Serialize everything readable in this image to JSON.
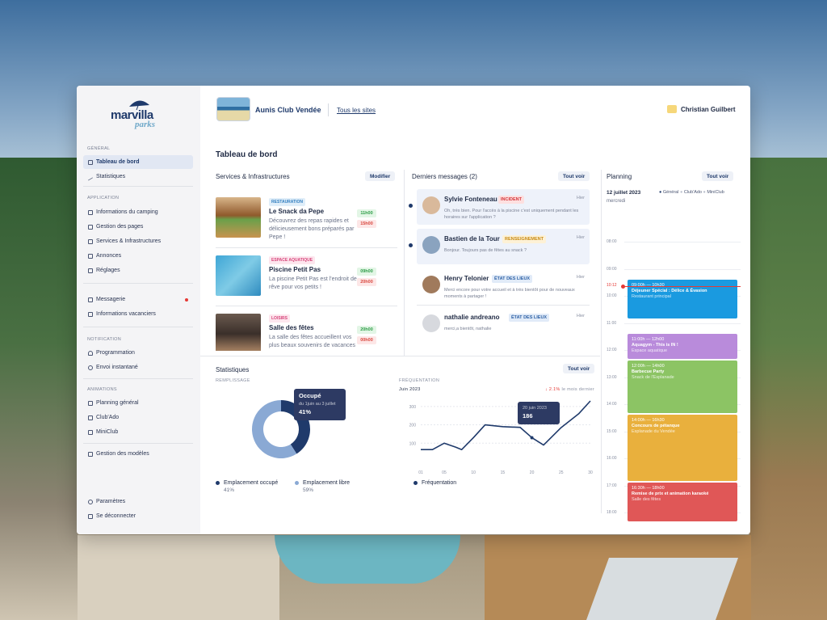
{
  "brand": {
    "logo_main": "marvilla",
    "logo_sub": "parks"
  },
  "site": {
    "name": "Aunis Club Vendée",
    "all_sites": "Tous les sites"
  },
  "user": {
    "name": "Christian Guilbert"
  },
  "sidebar": {
    "sections": {
      "general": "GÉNÉRAL",
      "application": "APPLICATION",
      "notification": "NOTIFICATION",
      "animations": "ANIMATIONS"
    },
    "items": {
      "dashboard": "Tableau de bord",
      "stats": "Statistiques",
      "camping": "Informations du camping",
      "pages": "Gestion des pages",
      "services": "Services & Infrastructures",
      "annonces": "Annonces",
      "reglages": "Réglages",
      "messagerie": "Messagerie",
      "infos_vacanciers": "Informations vacanciers",
      "programmation": "Programmation",
      "envoi": "Envoi instantané",
      "planning": "Planning général",
      "clubado": "Club'Ado",
      "miniclub": "MiniClub",
      "modeles": "Gestion des modèles",
      "parametres": "Paramètres",
      "deconnexion": "Se déconnecter"
    }
  },
  "page_title": "Tableau de bord",
  "services": {
    "title": "Services & Infrastructures",
    "edit": "Modifier",
    "items": [
      {
        "tag": "RESTAURATION",
        "name": "Le Snack da Pepe",
        "desc": "Découvrez des repas rapides et délicieusement bons préparés par Pepe !",
        "open": "11h00",
        "close": "15h00"
      },
      {
        "tag": "ESPACE AQUATIQUE",
        "name": "Piscine Petit Pas",
        "desc": "La piscine Petit Pas est l'endroit de rêve pour vos petits !",
        "open": "09h00",
        "close": "20h00"
      },
      {
        "tag": "LOISIRS",
        "name": "Salle des fêtes",
        "desc": "La salle des fêtes accueillent vos plus beaux souvenirs de vacances",
        "open": "20h00",
        "close": "00h00"
      }
    ]
  },
  "messages": {
    "title": "Derniers messages (2)",
    "see_all": "Tout voir",
    "items": [
      {
        "name": "Sylvie Fonteneau",
        "tag": "INCIDENT",
        "date": "Hier",
        "preview": "Oh, très bien. Pour l'accès à la piscine c'est uniquement pendant les horaires sur l'application ?"
      },
      {
        "name": "Bastien de la Tour",
        "tag": "RENSEIGNEMENT",
        "date": "Hier",
        "preview": "Bonjour. Toujours pas de fêtes au snack ?"
      },
      {
        "name": "Henry Telonier",
        "tag": "ÉTAT DES LIEUX",
        "date": "Hier",
        "preview": "Merci encore pour votre accueil et à très bientôt pour de nouveaux moments à partager !"
      },
      {
        "name": "nathalie andreano",
        "tag": "ÉTAT DES LIEUX",
        "date": "Hier",
        "preview": "merci,a bientôt, nathalie"
      }
    ]
  },
  "stats": {
    "title": "Statistiques",
    "see_all": "Tout voir",
    "fill_caption": "REMPLISSAGE",
    "freq_caption": "FRÉQUENTATION"
  },
  "chart_data": [
    {
      "type": "pie",
      "categories": [
        "Emplacement occupé",
        "Emplacement libre"
      ],
      "values": [
        41,
        59
      ],
      "value_labels": [
        "41%",
        "59%"
      ],
      "colors": [
        "#1f3a6b",
        "#8aa9d4"
      ],
      "tooltip": {
        "title": "Occupé",
        "range": "du 1juin au 3 juillet",
        "value": "41%"
      }
    },
    {
      "type": "line",
      "title": "Juin 2023",
      "delta": "↓ 2.1%",
      "delta_label": "le mois dernier",
      "x": [
        1,
        3,
        5,
        7,
        8,
        10,
        12,
        15,
        18,
        20,
        22,
        25,
        28,
        30
      ],
      "xticks": [
        "01",
        "05",
        "10",
        "15",
        "20",
        "25",
        "30"
      ],
      "y": [
        65,
        65,
        100,
        78,
        65,
        130,
        200,
        190,
        186,
        130,
        90,
        185,
        260,
        330
      ],
      "yticks": [
        100,
        200,
        300
      ],
      "ylim": [
        0,
        330
      ],
      "color": "#1f3a6b",
      "series_name": "Fréquentation",
      "tooltip": {
        "date": "20 juin 2023",
        "value": "186"
      }
    }
  ],
  "planning": {
    "title": "Planning",
    "see_all": "Tout voir",
    "date": "12 juillet 2023",
    "weekday": "mercredi",
    "filters": [
      "Général",
      "Club'Ado",
      "MiniClub"
    ],
    "now": "10:12",
    "hours": [
      "08:00",
      "09:00",
      "10:00",
      "11:00",
      "12:00",
      "13:00",
      "14:00",
      "15:00",
      "16:00",
      "17:00",
      "18:00"
    ],
    "events": [
      {
        "time": "09:00h — 10h30",
        "title": "Déjeuner Spécial : Délice & Évasion",
        "place": "Restaurant principal",
        "color": "#1a9ae0"
      },
      {
        "time": "11:00h — 12h00",
        "title": "Aquagym - This is IN !",
        "place": "Espace aquatique",
        "color": "#b98bdb"
      },
      {
        "time": "12:00h — 14h00",
        "title": "Barbecue Party",
        "place": "Snack de l'Esplanade",
        "color": "#8cc464"
      },
      {
        "time": "14:00h — 16h30",
        "title": "Concours de pétanque",
        "place": "Esplanade du Vendée",
        "color": "#e9b03d"
      },
      {
        "time": "16:30h — 18h00",
        "title": "Remise de prix et animation karaoké",
        "place": "Salle des fêtes",
        "color": "#e05757"
      }
    ]
  },
  "help": "?"
}
